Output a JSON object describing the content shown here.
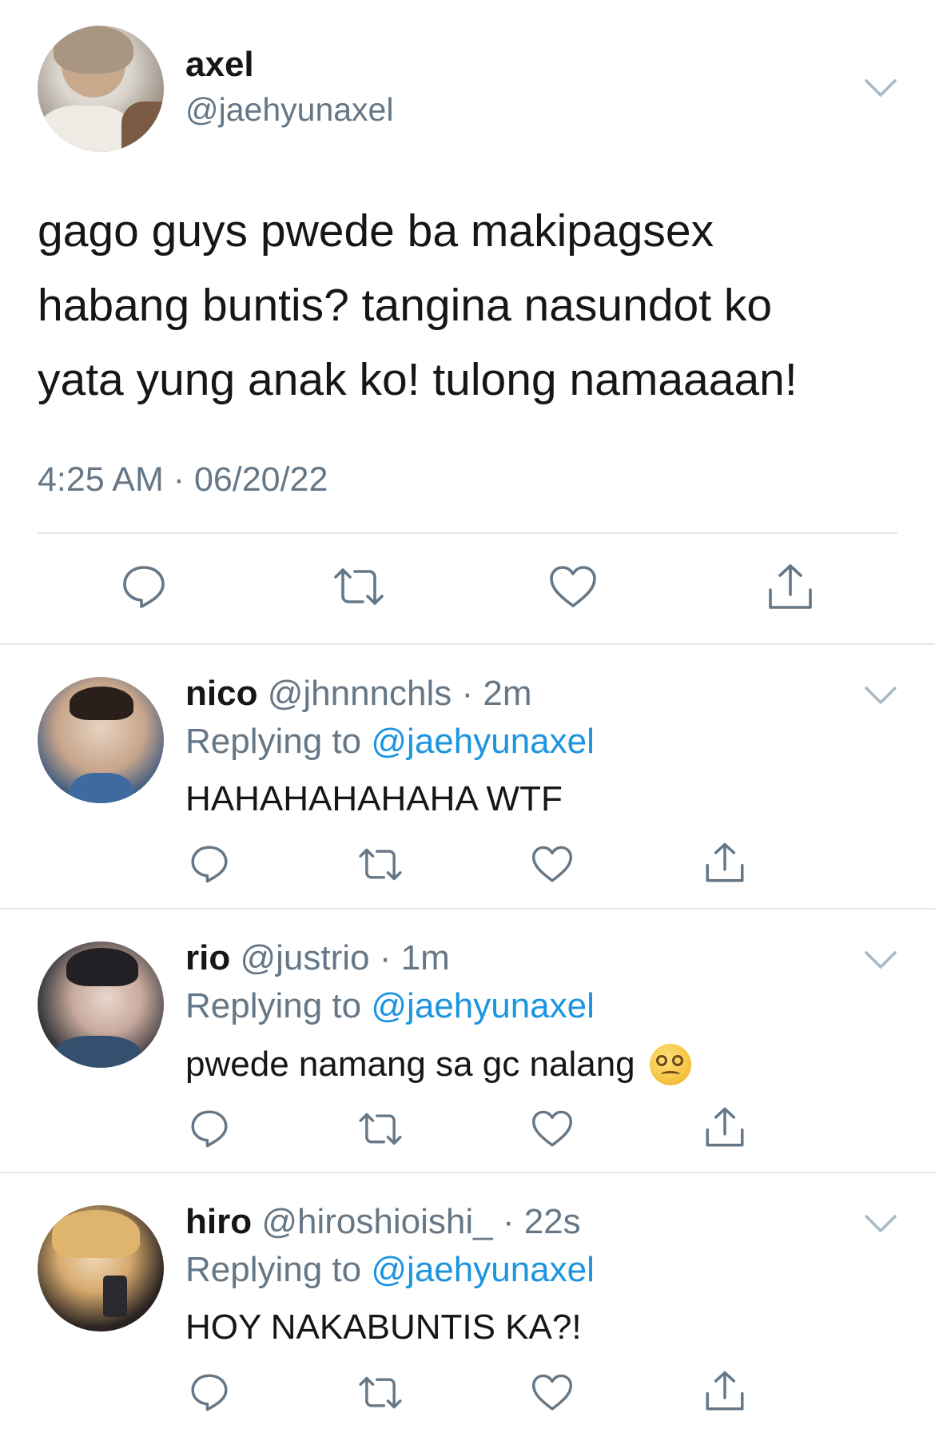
{
  "main_tweet": {
    "name": "axel",
    "handle": "@jaehyunaxel",
    "text": "gago guys pwede ba makipagsex\nhabang buntis? tangina nasundot ko\nyata yung anak ko! tulong namaaaan!",
    "timestamp": "4:25 AM · 06/20/22",
    "icons": [
      "reply-icon",
      "retweet-icon",
      "like-icon",
      "share-icon"
    ]
  },
  "replies": [
    {
      "name": "nico",
      "meta": "@jhnnnchls · 2m",
      "replying_label": "Replying to",
      "replying_handle": "@jaehyunaxel",
      "text": "HAHAHAHAHAHA WTF"
    },
    {
      "name": "rio",
      "meta": "@justrio · 1m",
      "replying_label": "Replying to",
      "replying_handle": "@jaehyunaxel",
      "text": "pwede namang sa gc nalang",
      "emoji": "dizzy-face-emoji"
    },
    {
      "name": "hiro",
      "meta": "@hiroshioishi_ · 22s",
      "replying_label": "Replying to",
      "replying_handle": "@jaehyunaxel",
      "text": "HOY NAKABUNTIS KA?!"
    }
  ],
  "colors": {
    "text": "#14171a",
    "secondary": "#657786",
    "link": "#1b95e0",
    "divider": "#e1e8ed"
  }
}
